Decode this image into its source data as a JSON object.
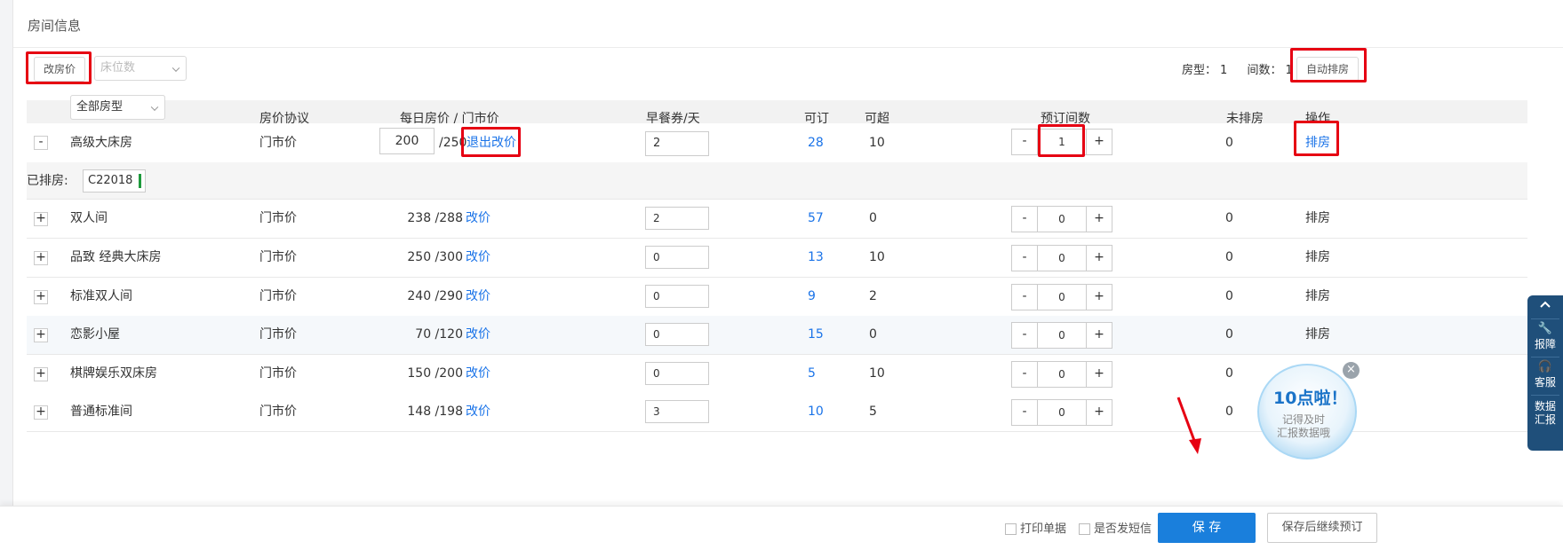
{
  "panel": {
    "title": "房间信息"
  },
  "toolbar": {
    "edit_price_label": "改房价",
    "bed_count_placeholder": "床位数",
    "room_type_label": "房型：",
    "room_type_count": "1",
    "room_count_label": "间数：",
    "room_count": "1",
    "auto_assign_label": "自动排房"
  },
  "table": {
    "room_type_filter": "全部房型",
    "headers": {
      "agreement": "房价协议",
      "price": "每日房价 / 门市价",
      "breakfast": "早餐券/天",
      "bookable": "可订",
      "overbook": "可超",
      "reserve": "预订间数",
      "unassigned": "未排房",
      "action": "操作"
    },
    "first_row": {
      "toggle": "-",
      "name": "高级大床房",
      "agreement": "门市价",
      "price_input": "200",
      "market_price": "/250",
      "price_action": "退出改价",
      "breakfast": "2",
      "bookable": "28",
      "overbook": "10",
      "reserve": "1",
      "unassigned": "0",
      "action": "排房"
    },
    "assigned": {
      "label": "已排房:",
      "room": "C22018"
    },
    "rows": [
      {
        "toggle": "+",
        "name": "双人间",
        "agreement": "门市价",
        "price": "238 /288",
        "price_action": "改价",
        "breakfast": "2",
        "bookable": "57",
        "overbook": "0",
        "reserve": "0",
        "unassigned": "0",
        "action": "排房"
      },
      {
        "toggle": "+",
        "name": "品致 经典大床房",
        "agreement": "门市价",
        "price": "250 /300",
        "price_action": "改价",
        "breakfast": "0",
        "bookable": "13",
        "overbook": "10",
        "reserve": "0",
        "unassigned": "0",
        "action": "排房"
      },
      {
        "toggle": "+",
        "name": "标准双人间",
        "agreement": "门市价",
        "price": "240 /290",
        "price_action": "改价",
        "breakfast": "0",
        "bookable": "9",
        "overbook": "2",
        "reserve": "0",
        "unassigned": "0",
        "action": "排房"
      },
      {
        "toggle": "+",
        "name": "恋影小屋",
        "agreement": "门市价",
        "price": "70 /120",
        "price_action": "改价",
        "breakfast": "0",
        "bookable": "15",
        "overbook": "0",
        "reserve": "0",
        "unassigned": "0",
        "action": "排房"
      },
      {
        "toggle": "+",
        "name": "棋牌娱乐双床房",
        "agreement": "门市价",
        "price": "150 /200",
        "price_action": "改价",
        "breakfast": "0",
        "bookable": "5",
        "overbook": "10",
        "reserve": "0",
        "unassigned": "0",
        "action": ""
      },
      {
        "toggle": "+",
        "name": "普通标准间",
        "agreement": "门市价",
        "price": "148 /198",
        "price_action": "改价",
        "breakfast": "3",
        "bookable": "10",
        "overbook": "5",
        "reserve": "0",
        "unassigned": "0",
        "action": ""
      }
    ],
    "stepper_minus": "-",
    "stepper_plus": "+"
  },
  "footer": {
    "print_label": "打印单据",
    "sms_label": "是否发短信",
    "save_label": "保 存",
    "save_continue_label": "保存后继续预订"
  },
  "side_widget": {
    "report_label": "报障",
    "service_label": "客服",
    "data_label_1": "数据",
    "data_label_2": "汇报"
  },
  "reminder": {
    "headline": "10点啦！",
    "line1": "记得及时",
    "line2": "汇报数据哦"
  },
  "colors": {
    "link": "#1a73e8",
    "primary": "#1a7fdc",
    "annotation_red": "#e60012",
    "side_bar": "#1f4f7a",
    "assigned_marker": "#1e9a3c"
  }
}
